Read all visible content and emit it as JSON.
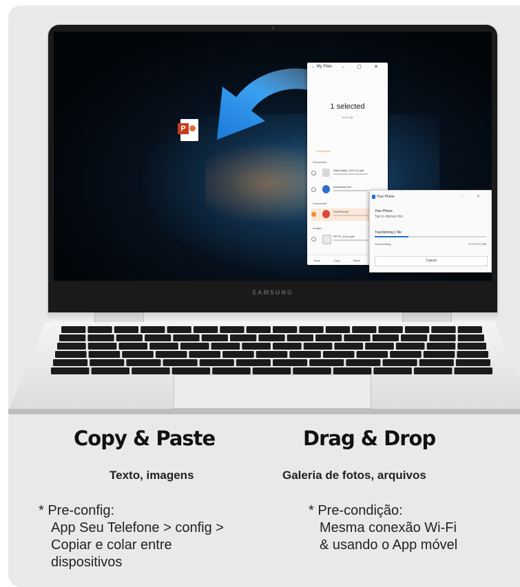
{
  "laptop": {
    "brand": "SAMSUNG",
    "my_files_window": {
      "title": "My Files",
      "selected_text": "1 selected",
      "selected_size": "00.00 kB",
      "folder_label": "> Download",
      "sections": [
        "Documents",
        "Documents",
        "Images"
      ],
      "files": [
        {
          "name": "Island table_0123 (1).pdf",
          "color": "#d9d9d9"
        },
        {
          "name": "download.html",
          "color": "#2a6fc9"
        },
        {
          "name": "ChefFood.fe",
          "color": "#d84a3a"
        },
        {
          "name": "PPTIV_ICon.pptx",
          "color": "#e8e8e8"
        }
      ],
      "footer": [
        "Move",
        "Copy",
        "Share",
        "Delete"
      ]
    },
    "your_phone_toast": {
      "app_name": "Your Phone",
      "heading": "Your Phone",
      "subtitle": "Tap to dismiss this",
      "transfer_title": "Transferring 1 file",
      "progress": 0.3,
      "status_left": "Downloading...",
      "status_right": "4.07/20.51 MB",
      "cancel_label": "Cancel"
    },
    "icons": [
      "drag-arrow-icon",
      "powerpoint-file-icon"
    ]
  },
  "features": {
    "copy_paste": {
      "title": "Copy & Paste",
      "subtitle": "Texto, imagens",
      "note_lines": [
        "* Pre-config:",
        "App Seu Telefone > config >",
        "Copiar e colar entre",
        "dispositivos"
      ]
    },
    "drag_drop": {
      "title": "Drag & Drop",
      "subtitle": "Galeria de fotos, arquivos",
      "note_lines": [
        "* Pre-condição:",
        "Mesma conexão Wi-Fi",
        "& usando o App móvel"
      ]
    }
  },
  "colors": {
    "card_background": "#e9e9e9",
    "arrow_blue": "#2a8be0",
    "powerpoint_red": "#c43e1c",
    "progress_blue": "#1f6fd1"
  }
}
